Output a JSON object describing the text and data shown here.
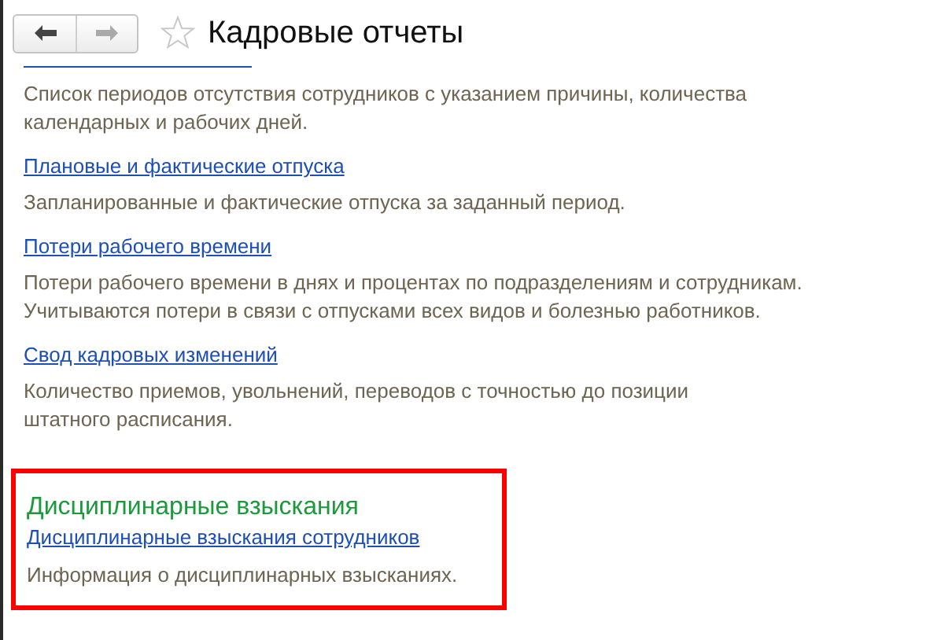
{
  "header": {
    "title": "Кадровые отчеты",
    "favorite": false,
    "nav": [
      {
        "kind": "back",
        "disabled": false
      },
      {
        "kind": "forward",
        "disabled": true
      }
    ]
  },
  "reports": [
    {
      "title_hidden": true,
      "description": "Список периодов отсутствия сотрудников с указанием причины, количества\nкалендарных и рабочих дней."
    },
    {
      "title": "Плановые и фактические отпуска",
      "description": "Запланированные и фактические отпуска за заданный период."
    },
    {
      "title": "Потери рабочего времени",
      "description": "Потери рабочего времени в днях и процентах по подразделениям и сотрудникам.\nУчитываются потери в связи с отпусками всех видов и болезнью работников."
    },
    {
      "title": "Свод кадровых изменений",
      "description": "Количество приемов, увольнений, переводов с точностью до позиции\nштатного расписания."
    }
  ],
  "section": {
    "title": "Дисциплинарные взыскания",
    "highlighted": true,
    "reports": [
      {
        "title": "Дисциплинарные взыскания сотрудников",
        "description": "Информация о дисциплинарных взысканиях."
      }
    ]
  }
}
